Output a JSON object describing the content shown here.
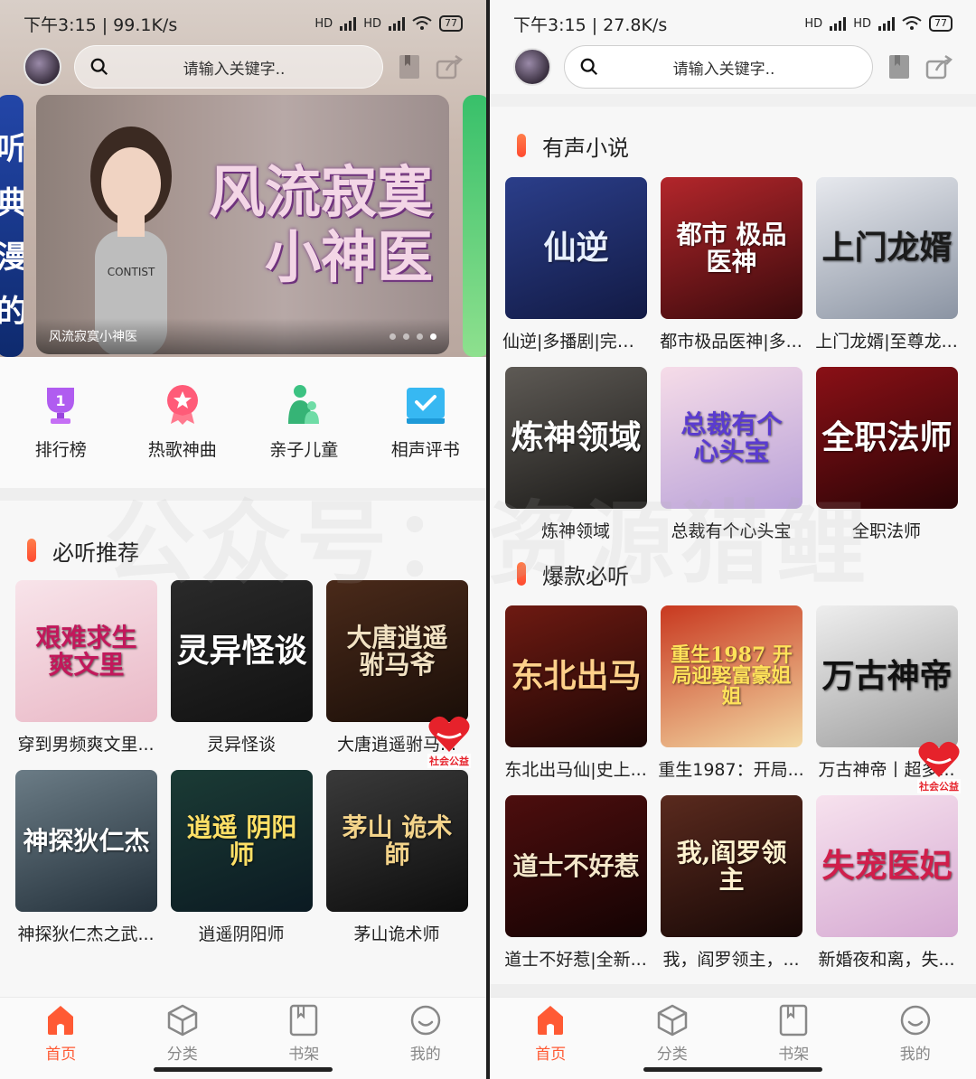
{
  "left": {
    "status": {
      "time": "下午3:15 | 99.1K/s",
      "sig1": "HD",
      "sig2": "HD",
      "battery": "77"
    },
    "search_placeholder": "请输入关键字..",
    "banner": {
      "title_line1": "风流寂寞",
      "title_line2": "小神医",
      "caption": "风流寂寞小神医",
      "side_left_text": "听典漫的"
    },
    "quick": [
      {
        "label": "排行榜",
        "icon": "trophy-icon",
        "color": "#a54be8"
      },
      {
        "label": "热歌神曲",
        "icon": "star-medal-icon",
        "color": "#ff4d6a"
      },
      {
        "label": "亲子儿童",
        "icon": "parent-child-icon",
        "color": "#33b877"
      },
      {
        "label": "相声评书",
        "icon": "book-check-icon",
        "color": "#2fb2f0"
      }
    ],
    "section_title": "必听推荐",
    "books": [
      {
        "title": "穿到男频爽文里...",
        "cover_text": "艰难求生 爽文里",
        "bg": "linear-gradient(160deg,#f8e4ea,#e9b8c6)",
        "fg": "#c2185b"
      },
      {
        "title": "灵异怪谈",
        "cover_text": "灵异怪谈",
        "bg": "linear-gradient(160deg,#2a2a2a,#111)",
        "fg": "#ffffff"
      },
      {
        "title": "大唐逍遥驸马...",
        "cover_text": "大唐逍遥 驸马爷",
        "bg": "linear-gradient(160deg,#4a2a1a,#1a0e08)",
        "fg": "#f1e1c2"
      },
      {
        "title": "神探狄仁杰之武...",
        "cover_text": "神探狄仁杰",
        "bg": "linear-gradient(160deg,#6b7c86,#23303a)",
        "fg": "#ffffff"
      },
      {
        "title": "逍遥阴阳师",
        "cover_text": "逍遥 阴阳师",
        "bg": "linear-gradient(160deg,#1b3b35,#0b1a22)",
        "fg": "#ffe066"
      },
      {
        "title": "茅山诡术师",
        "cover_text": "茅山 诡术師",
        "bg": "linear-gradient(160deg,#3a3a3a,#0d0d0d)",
        "fg": "#f3d38a"
      }
    ],
    "charity_text": "社会公益"
  },
  "right": {
    "status": {
      "time": "下午3:15 | 27.8K/s",
      "sig1": "HD",
      "sig2": "HD",
      "battery": "77"
    },
    "search_placeholder": "请输入关键字..",
    "section1_title": "有声小说",
    "books1": [
      {
        "title": "仙逆|多播剧|完结...",
        "cover_text": "仙逆",
        "bg": "linear-gradient(160deg,#2b3e8a,#121a44)",
        "fg": "#e8f0ff"
      },
      {
        "title": "都市极品医神|多...",
        "cover_text": "都市 极品医神",
        "bg": "linear-gradient(160deg,#b3262b,#3a0a0c)",
        "fg": "#ffffff"
      },
      {
        "title": "上门龙婿|至尊龙...",
        "cover_text": "上门龙婿",
        "bg": "linear-gradient(160deg,#e7e9ee,#8b94a3)",
        "fg": "#1b1b1b"
      },
      {
        "title": "炼神领域",
        "cover_text": "炼神领域",
        "bg": "linear-gradient(160deg,#5e5a55,#1b1a18)",
        "fg": "#ffffff"
      },
      {
        "title": "总裁有个心头宝",
        "cover_text": "总裁有个 心头宝",
        "bg": "linear-gradient(160deg,#f6dce8,#b8a1d8)",
        "fg": "#5a3bd0"
      },
      {
        "title": "全职法师",
        "cover_text": "全职法师",
        "bg": "linear-gradient(160deg,#8a1016,#2a0406)",
        "fg": "#ffffff"
      }
    ],
    "section2_title": "爆款必听",
    "books2": [
      {
        "title": "东北出马仙|史上...",
        "cover_text": "东北出马",
        "bg": "linear-gradient(160deg,#6e1a12,#1b0604)",
        "fg": "#ffd08a"
      },
      {
        "title": "重生1987：开局...",
        "cover_text": "重生1987 开局迎娶富豪姐姐",
        "bg": "linear-gradient(160deg,#c8381f,#f3d9a4)",
        "fg": "#ffe25a"
      },
      {
        "title": "万古神帝丨超多...",
        "cover_text": "万古神帝",
        "bg": "linear-gradient(160deg,#eeeeee,#9f9f9f)",
        "fg": "#111111"
      },
      {
        "title": "道士不好惹|全新...",
        "cover_text": "道士不好惹",
        "bg": "linear-gradient(160deg,#4d0e0e,#140303)",
        "fg": "#f4e6c9"
      },
      {
        "title": "我，阎罗领主，...",
        "cover_text": "我,阎罗领主",
        "bg": "linear-gradient(160deg,#5a2a1e,#170806)",
        "fg": "#fff2cf"
      },
      {
        "title": "新婚夜和离，失...",
        "cover_text": "失宠医妃",
        "bg": "linear-gradient(160deg,#f7e2ee,#d5a9d2)",
        "fg": "#d01e4b"
      }
    ],
    "charity_text": "社会公益"
  },
  "tabs": [
    {
      "label": "首页",
      "icon": "home-icon"
    },
    {
      "label": "分类",
      "icon": "category-cube-icon"
    },
    {
      "label": "书架",
      "icon": "bookshelf-icon"
    },
    {
      "label": "我的",
      "icon": "profile-icon"
    }
  ],
  "colors": {
    "accent": "#ff5a34",
    "charity": "#e6222b"
  },
  "watermark": "公众号：资源猎鲤"
}
